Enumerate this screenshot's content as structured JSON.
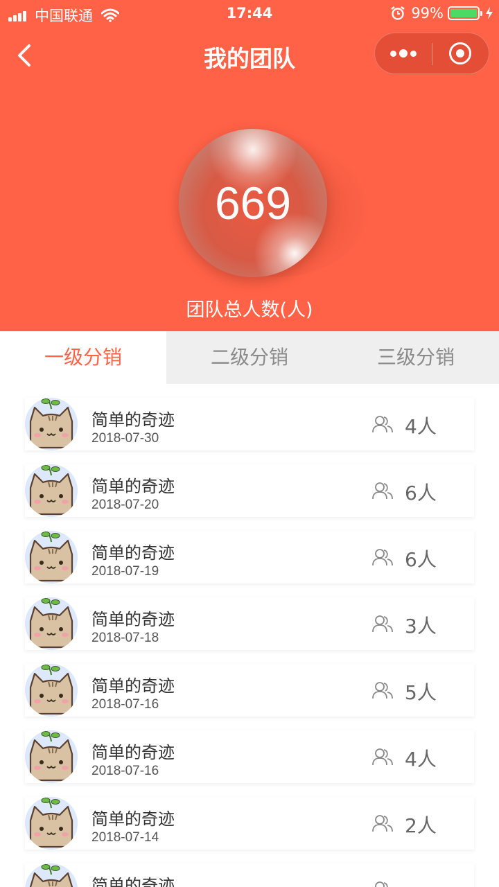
{
  "status_bar": {
    "carrier": "中国联通",
    "time": "17:44",
    "battery": "99%",
    "battery_level": 0.99
  },
  "nav": {
    "title": "我的团队"
  },
  "summary": {
    "total": "669",
    "label": "团队总人数(人)"
  },
  "tabs": [
    {
      "label": "一级分销",
      "active": true
    },
    {
      "label": "二级分销",
      "active": false
    },
    {
      "label": "三级分销",
      "active": false
    }
  ],
  "members": [
    {
      "name": "简单的奇迹",
      "date": "2018-07-30",
      "count": "4人"
    },
    {
      "name": "简单的奇迹",
      "date": "2018-07-20",
      "count": "6人"
    },
    {
      "name": "简单的奇迹",
      "date": "2018-07-19",
      "count": "6人"
    },
    {
      "name": "简单的奇迹",
      "date": "2018-07-18",
      "count": "3人"
    },
    {
      "name": "简单的奇迹",
      "date": "2018-07-16",
      "count": "5人"
    },
    {
      "name": "简单的奇迹",
      "date": "2018-07-16",
      "count": "4人"
    },
    {
      "name": "简单的奇迹",
      "date": "2018-07-14",
      "count": "2人"
    },
    {
      "name": "简单的奇迹",
      "date": "",
      "count": ""
    }
  ],
  "colors": {
    "accent": "#ff6247",
    "tab_inactive_bg": "#efefef",
    "avatar_bg": "#dde8fb"
  },
  "icons": {
    "back": "chevron-left-icon",
    "more": "more-dots-icon",
    "close": "target-circle-icon",
    "people": "people-icon",
    "wifi": "wifi-icon",
    "alarm": "alarm-icon",
    "charging": "bolt-icon"
  }
}
